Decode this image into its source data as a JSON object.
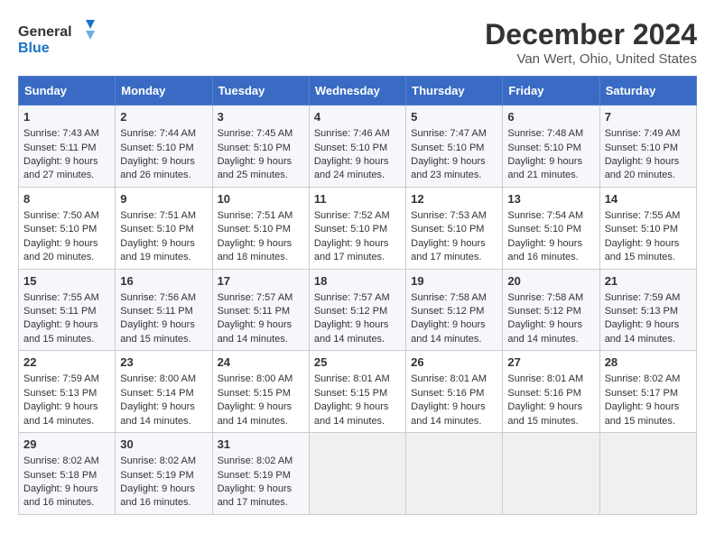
{
  "logo": {
    "line1": "General",
    "line2": "Blue"
  },
  "title": "December 2024",
  "location": "Van Wert, Ohio, United States",
  "days_of_week": [
    "Sunday",
    "Monday",
    "Tuesday",
    "Wednesday",
    "Thursday",
    "Friday",
    "Saturday"
  ],
  "weeks": [
    [
      {
        "day": "1",
        "sunrise": "Sunrise: 7:43 AM",
        "sunset": "Sunset: 5:11 PM",
        "daylight": "Daylight: 9 hours and 27 minutes."
      },
      {
        "day": "2",
        "sunrise": "Sunrise: 7:44 AM",
        "sunset": "Sunset: 5:10 PM",
        "daylight": "Daylight: 9 hours and 26 minutes."
      },
      {
        "day": "3",
        "sunrise": "Sunrise: 7:45 AM",
        "sunset": "Sunset: 5:10 PM",
        "daylight": "Daylight: 9 hours and 25 minutes."
      },
      {
        "day": "4",
        "sunrise": "Sunrise: 7:46 AM",
        "sunset": "Sunset: 5:10 PM",
        "daylight": "Daylight: 9 hours and 24 minutes."
      },
      {
        "day": "5",
        "sunrise": "Sunrise: 7:47 AM",
        "sunset": "Sunset: 5:10 PM",
        "daylight": "Daylight: 9 hours and 23 minutes."
      },
      {
        "day": "6",
        "sunrise": "Sunrise: 7:48 AM",
        "sunset": "Sunset: 5:10 PM",
        "daylight": "Daylight: 9 hours and 21 minutes."
      },
      {
        "day": "7",
        "sunrise": "Sunrise: 7:49 AM",
        "sunset": "Sunset: 5:10 PM",
        "daylight": "Daylight: 9 hours and 20 minutes."
      }
    ],
    [
      {
        "day": "8",
        "sunrise": "Sunrise: 7:50 AM",
        "sunset": "Sunset: 5:10 PM",
        "daylight": "Daylight: 9 hours and 20 minutes."
      },
      {
        "day": "9",
        "sunrise": "Sunrise: 7:51 AM",
        "sunset": "Sunset: 5:10 PM",
        "daylight": "Daylight: 9 hours and 19 minutes."
      },
      {
        "day": "10",
        "sunrise": "Sunrise: 7:51 AM",
        "sunset": "Sunset: 5:10 PM",
        "daylight": "Daylight: 9 hours and 18 minutes."
      },
      {
        "day": "11",
        "sunrise": "Sunrise: 7:52 AM",
        "sunset": "Sunset: 5:10 PM",
        "daylight": "Daylight: 9 hours and 17 minutes."
      },
      {
        "day": "12",
        "sunrise": "Sunrise: 7:53 AM",
        "sunset": "Sunset: 5:10 PM",
        "daylight": "Daylight: 9 hours and 17 minutes."
      },
      {
        "day": "13",
        "sunrise": "Sunrise: 7:54 AM",
        "sunset": "Sunset: 5:10 PM",
        "daylight": "Daylight: 9 hours and 16 minutes."
      },
      {
        "day": "14",
        "sunrise": "Sunrise: 7:55 AM",
        "sunset": "Sunset: 5:10 PM",
        "daylight": "Daylight: 9 hours and 15 minutes."
      }
    ],
    [
      {
        "day": "15",
        "sunrise": "Sunrise: 7:55 AM",
        "sunset": "Sunset: 5:11 PM",
        "daylight": "Daylight: 9 hours and 15 minutes."
      },
      {
        "day": "16",
        "sunrise": "Sunrise: 7:56 AM",
        "sunset": "Sunset: 5:11 PM",
        "daylight": "Daylight: 9 hours and 15 minutes."
      },
      {
        "day": "17",
        "sunrise": "Sunrise: 7:57 AM",
        "sunset": "Sunset: 5:11 PM",
        "daylight": "Daylight: 9 hours and 14 minutes."
      },
      {
        "day": "18",
        "sunrise": "Sunrise: 7:57 AM",
        "sunset": "Sunset: 5:12 PM",
        "daylight": "Daylight: 9 hours and 14 minutes."
      },
      {
        "day": "19",
        "sunrise": "Sunrise: 7:58 AM",
        "sunset": "Sunset: 5:12 PM",
        "daylight": "Daylight: 9 hours and 14 minutes."
      },
      {
        "day": "20",
        "sunrise": "Sunrise: 7:58 AM",
        "sunset": "Sunset: 5:12 PM",
        "daylight": "Daylight: 9 hours and 14 minutes."
      },
      {
        "day": "21",
        "sunrise": "Sunrise: 7:59 AM",
        "sunset": "Sunset: 5:13 PM",
        "daylight": "Daylight: 9 hours and 14 minutes."
      }
    ],
    [
      {
        "day": "22",
        "sunrise": "Sunrise: 7:59 AM",
        "sunset": "Sunset: 5:13 PM",
        "daylight": "Daylight: 9 hours and 14 minutes."
      },
      {
        "day": "23",
        "sunrise": "Sunrise: 8:00 AM",
        "sunset": "Sunset: 5:14 PM",
        "daylight": "Daylight: 9 hours and 14 minutes."
      },
      {
        "day": "24",
        "sunrise": "Sunrise: 8:00 AM",
        "sunset": "Sunset: 5:15 PM",
        "daylight": "Daylight: 9 hours and 14 minutes."
      },
      {
        "day": "25",
        "sunrise": "Sunrise: 8:01 AM",
        "sunset": "Sunset: 5:15 PM",
        "daylight": "Daylight: 9 hours and 14 minutes."
      },
      {
        "day": "26",
        "sunrise": "Sunrise: 8:01 AM",
        "sunset": "Sunset: 5:16 PM",
        "daylight": "Daylight: 9 hours and 14 minutes."
      },
      {
        "day": "27",
        "sunrise": "Sunrise: 8:01 AM",
        "sunset": "Sunset: 5:16 PM",
        "daylight": "Daylight: 9 hours and 15 minutes."
      },
      {
        "day": "28",
        "sunrise": "Sunrise: 8:02 AM",
        "sunset": "Sunset: 5:17 PM",
        "daylight": "Daylight: 9 hours and 15 minutes."
      }
    ],
    [
      {
        "day": "29",
        "sunrise": "Sunrise: 8:02 AM",
        "sunset": "Sunset: 5:18 PM",
        "daylight": "Daylight: 9 hours and 16 minutes."
      },
      {
        "day": "30",
        "sunrise": "Sunrise: 8:02 AM",
        "sunset": "Sunset: 5:19 PM",
        "daylight": "Daylight: 9 hours and 16 minutes."
      },
      {
        "day": "31",
        "sunrise": "Sunrise: 8:02 AM",
        "sunset": "Sunset: 5:19 PM",
        "daylight": "Daylight: 9 hours and 17 minutes."
      },
      null,
      null,
      null,
      null
    ]
  ]
}
